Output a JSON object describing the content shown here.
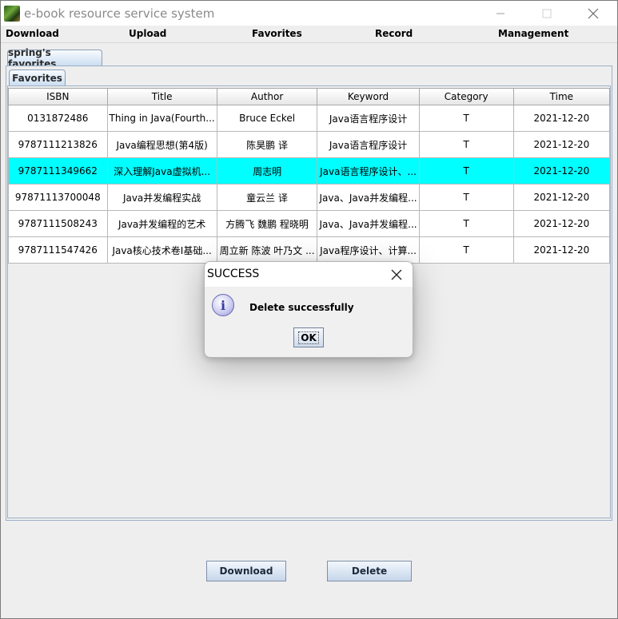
{
  "window": {
    "title": "e-book resource service system"
  },
  "menubar": {
    "items": [
      "Download",
      "Upload",
      "Favorites",
      "Record",
      "Management"
    ]
  },
  "outer_tab": {
    "label": "spring's favorites"
  },
  "inner_tab": {
    "label": "Favorites"
  },
  "table": {
    "columns": [
      "ISBN",
      "Title",
      "Author",
      "Keyword",
      "Category",
      "Time"
    ],
    "rows": [
      [
        "0131872486",
        "Thing in Java(Fourth...",
        "Bruce Eckel",
        "Java语言程序设计",
        "T",
        "2021-12-20"
      ],
      [
        "9787111213826",
        "Java编程思想(第4版)",
        "陈昊鹏 译",
        "Java语言程序设计",
        "T",
        "2021-12-20"
      ],
      [
        "9787111349662",
        "深入理解Java虚拟机...",
        "周志明",
        "Java语言程序设计、...",
        "T",
        "2021-12-20"
      ],
      [
        "97871113700048",
        "Java并发编程实战",
        "童云兰 译",
        "Java、Java并发编程...",
        "T",
        "2021-12-20"
      ],
      [
        "9787111508243",
        "Java并发编程的艺术",
        "方腾飞 魏鹏 程晓明",
        "Java、Java并发编程...",
        "T",
        "2021-12-20"
      ],
      [
        "9787111547426",
        "Java核心技术卷Ⅰ基础...",
        "周立新 陈波 叶乃文 ...",
        "Java程序设计、计算...",
        "T",
        "2021-12-20"
      ]
    ],
    "selected_row_index": 2
  },
  "buttons": {
    "download": "Download",
    "delete": "Delete"
  },
  "dialog": {
    "title": "SUCCESS",
    "message": "Delete successfully",
    "ok_label": "OK",
    "icon": "info-icon"
  },
  "colors": {
    "selected_row": "#00ffff",
    "tab_gradient_end": "#c9dcf0"
  }
}
